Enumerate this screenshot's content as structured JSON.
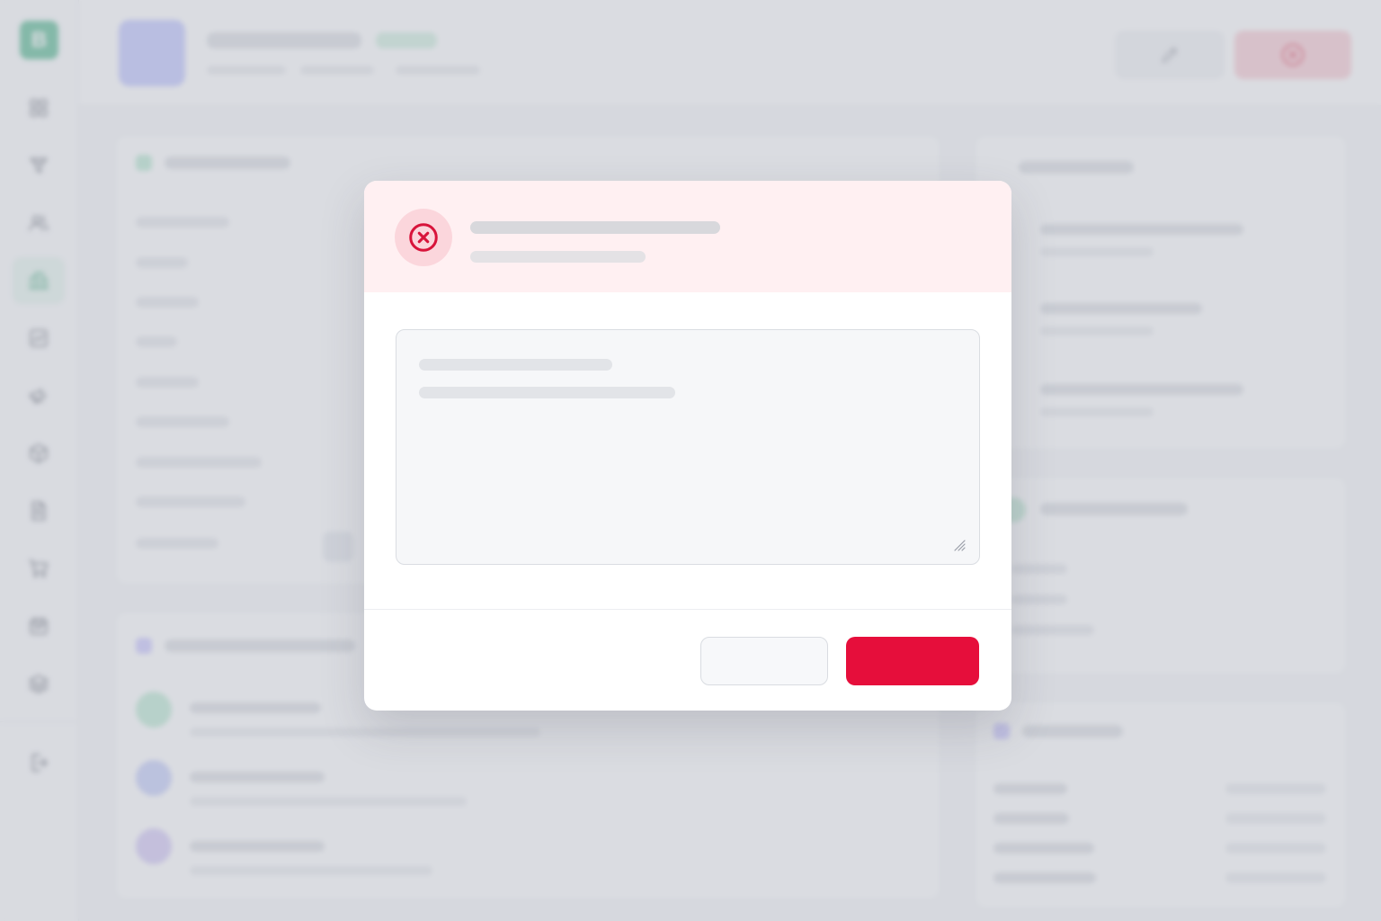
{
  "app": {
    "logo_letter": "B",
    "brand_color": "#1fa36c",
    "sidebar": {
      "items": [
        {
          "icon": "grid-icon",
          "active": false
        },
        {
          "icon": "filter-icon",
          "active": false
        },
        {
          "icon": "users-icon",
          "active": false
        },
        {
          "icon": "buildings-icon",
          "active": true
        },
        {
          "icon": "chart-icon",
          "active": false
        },
        {
          "icon": "megaphone-icon",
          "active": false
        },
        {
          "icon": "box-icon",
          "active": false
        },
        {
          "icon": "document-icon",
          "active": false
        },
        {
          "icon": "cart-icon",
          "active": false
        },
        {
          "icon": "calendar-icon",
          "active": false
        },
        {
          "icon": "layers-icon",
          "active": false
        }
      ],
      "footer_icon": "logout-icon"
    },
    "header": {
      "edit_icon": "pencil-icon",
      "reject_icon": "x-circle-icon"
    }
  },
  "modal": {
    "icon": "x-circle-icon",
    "accent_color": "#e60e3b",
    "title": "",
    "subtitle": "",
    "textarea": {
      "value": "",
      "placeholder": ""
    },
    "cancel_label": "",
    "confirm_label": ""
  }
}
